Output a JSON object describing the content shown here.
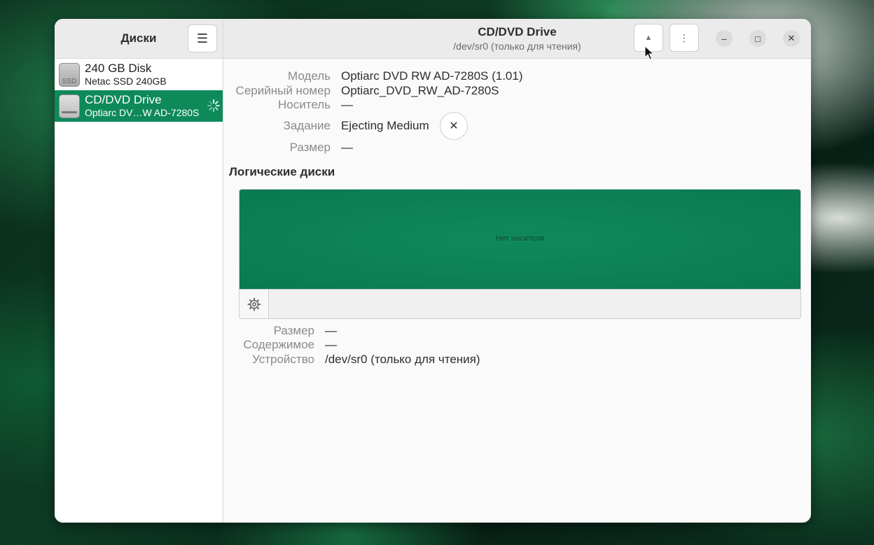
{
  "sidebar": {
    "title": "Диски",
    "menu_icon": "hamburger-icon",
    "disks": [
      {
        "name": "240 GB Disk",
        "sub": "Netac SSD 240GB",
        "icon_label": "SSD",
        "selected": false
      },
      {
        "name": "CD/DVD Drive",
        "sub": "Optiarc DV…W AD-7280S",
        "icon_label": "",
        "selected": true
      }
    ]
  },
  "header": {
    "title": "CD/DVD Drive",
    "subtitle": "/dev/sr0 (только для чтения)",
    "eject_icon": "▲",
    "more_icon": "⋮",
    "minimize_icon": "–",
    "maximize_icon": "□",
    "close_icon": "✕"
  },
  "details": {
    "model_label": "Модель",
    "model_value": "Optiarc DVD RW AD-7280S (1.01)",
    "serial_label": "Серийный номер",
    "serial_value": "Optiarc_DVD_RW_AD-7280S",
    "media_label": "Носитель",
    "media_value": "—",
    "job_label": "Задание",
    "job_value": "Ejecting Medium",
    "job_cancel_icon": "✕",
    "size_label": "Размер",
    "size_value": "—"
  },
  "volumes": {
    "title": "Логические диски",
    "no_media_text": "Нет носителя"
  },
  "volume_details": {
    "size_label": "Размер",
    "size_value": "—",
    "contents_label": "Содержимое",
    "contents_value": "—",
    "device_label": "Устройство",
    "device_value": "/dev/sr0 (только для чтения)"
  },
  "colors": {
    "accent": "#0e8a5a",
    "window_bg": "#fafafa"
  }
}
